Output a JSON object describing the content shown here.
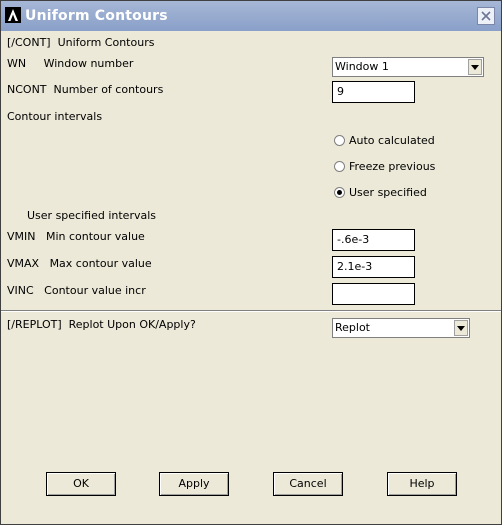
{
  "window": {
    "title": "Uniform Contours"
  },
  "header": {
    "label": "[/CONT]  Uniform Contours"
  },
  "wn": {
    "label": "WN     Window number",
    "value": "Window 1"
  },
  "ncont": {
    "label": "NCONT  Number of contours",
    "value": "9"
  },
  "intervals": {
    "label": "Contour intervals",
    "options": [
      "Auto calculated",
      "Freeze previous",
      "User specified"
    ],
    "selected": "User specified"
  },
  "user_intervals": {
    "label": "User specified intervals"
  },
  "vmin": {
    "label": "VMIN   Min contour value",
    "value": "-.6e-3"
  },
  "vmax": {
    "label": "VMAX   Max contour value",
    "value": "2.1e-3"
  },
  "vinc": {
    "label": "VINC   Contour value incr",
    "value": ""
  },
  "replot": {
    "label": "[/REPLOT]  Replot Upon OK/Apply?",
    "value": "Replot"
  },
  "buttons": {
    "ok": "OK",
    "apply": "Apply",
    "cancel": "Cancel",
    "help": "Help"
  },
  "icons": {
    "app": "ansys-logo-icon",
    "close": "close-icon",
    "dropdown": "chevron-down-icon"
  },
  "colors": {
    "title_bar": "#8aa0c9",
    "dialog_bg": "#ece9d8"
  }
}
